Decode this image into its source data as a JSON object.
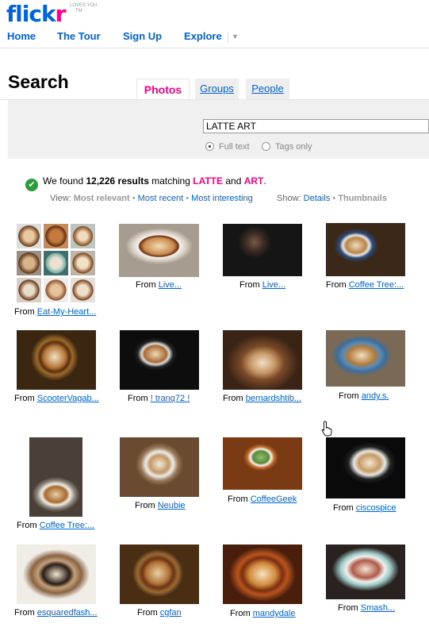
{
  "logo": {
    "part1": "flick",
    "part2": "r",
    "tagline": "LOVES YOU",
    "tm": "TM"
  },
  "nav": {
    "home": "Home",
    "tour": "The Tour",
    "signup": "Sign Up",
    "explore": "Explore",
    "arrow": "▼"
  },
  "page_title": "Search",
  "tabs": {
    "photos": "Photos",
    "groups": "Groups",
    "people": "People"
  },
  "search": {
    "value": "LATTE ART",
    "full_text": "Full text",
    "tags_only": "Tags only"
  },
  "results": {
    "pre": "We found ",
    "count": "12,226 results",
    "mid": " matching ",
    "kw1": "LATTE",
    "and": " and ",
    "kw2": "ART",
    "end": "."
  },
  "view": {
    "label": "View:",
    "relevant": "Most relevant",
    "recent": "Most recent",
    "interesting": "Most interesting",
    "show_label": "Show:",
    "details": "Details",
    "thumbnails": "Thumbnails",
    "sep": "•"
  },
  "photos": [
    {
      "from": "From",
      "owner": "Eat-My-Heart..."
    },
    {
      "from": "From",
      "owner": "Live..."
    },
    {
      "from": "From",
      "owner": "Live..."
    },
    {
      "from": "From",
      "owner": "Coffee Tree:..."
    },
    {
      "from": "From",
      "owner": "ScooterVagab..."
    },
    {
      "from": "From",
      "owner": "! tranq72 !"
    },
    {
      "from": "From",
      "owner": "bernardshtib..."
    },
    {
      "from": "From",
      "owner": "andy.s."
    },
    {
      "from": "From",
      "owner": "Coffee Tree:..."
    },
    {
      "from": "From",
      "owner": "Neubie"
    },
    {
      "from": "From",
      "owner": "CoffeeGeek"
    },
    {
      "from": "From",
      "owner": "ciscospice"
    },
    {
      "from": "From",
      "owner": "esquaredfash..."
    },
    {
      "from": "From",
      "owner": "cgfan"
    },
    {
      "from": "From",
      "owner": "mandydale"
    },
    {
      "from": "From",
      "owner": "Smash..."
    }
  ],
  "colors": {
    "brand_blue": "#0063dc",
    "brand_pink": "#ff0084"
  }
}
